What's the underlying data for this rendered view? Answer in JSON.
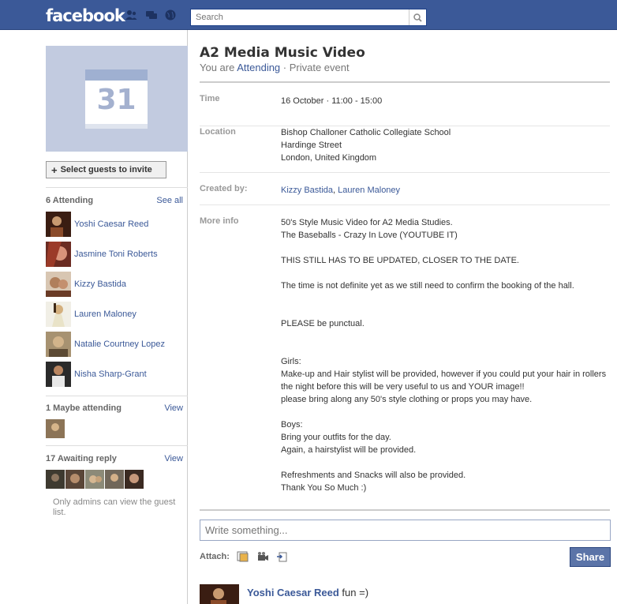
{
  "header": {
    "logo": "facebook",
    "search_placeholder": "Search"
  },
  "sidebar": {
    "calendar_day": "31",
    "invite_label": "Select guests to invite",
    "attending": {
      "heading": "6 Attending",
      "link": "See all",
      "guests": [
        {
          "name": "Yoshi Caesar Reed"
        },
        {
          "name": "Jasmine Toni Roberts"
        },
        {
          "name": "Kizzy Bastida"
        },
        {
          "name": "Lauren Maloney"
        },
        {
          "name": "Natalie Courtney Lopez"
        },
        {
          "name": "Nisha Sharp-Grant"
        }
      ]
    },
    "maybe": {
      "heading": "1 Maybe attending",
      "link": "View"
    },
    "awaiting": {
      "heading": "17 Awaiting reply",
      "link": "View",
      "note": "Only admins can view the guest list."
    }
  },
  "event": {
    "title": "A2 Media Music Video",
    "subtitle_prefix": "You are ",
    "rsvp_status": "Attending",
    "subtitle_suffix": " · Private event",
    "time_label": "Time",
    "time_value": "16 October · 11:00 - 15:00",
    "location_label": "Location",
    "location_value": "Bishop Challoner Catholic Collegiate School\nHardinge Street\nLondon, United Kingdom",
    "created_label": "Created by:",
    "creator_1": "Kizzy Bastida",
    "creator_sep": ", ",
    "creator_2": "Lauren Maloney",
    "info_label": "More info",
    "info_value": "50's Style Music Video for A2 Media Studies.\nThe Baseballs - Crazy In Love (YOUTUBE IT)\n\nTHIS STILL HAS TO BE UPDATED, CLOSER TO THE DATE.\n\nThe time is not definite yet as we still need to confirm the booking of the hall.\n\n\nPLEASE be punctual.\n\n\nGirls:\nMake-up and Hair stylist will be provided, however if you could put your hair in rollers the night before this will be very useful to us and YOUR image!!\nplease bring along any 50's style clothing or props you may have.\n\nBoys:\nBring your outfits for the day.\nAgain, a hairstylist will be provided.\n\nRefreshments and Snacks will also be provided.\nThank You So Much :)"
  },
  "composer": {
    "placeholder": "Write something...",
    "attach_label": "Attach:",
    "share_label": "Share"
  },
  "feed": {
    "post_author": "Yoshi Caesar Reed",
    "post_text": " fun =)"
  },
  "colors": {
    "brand": "#3b5998",
    "link": "#3b5998",
    "share": "#5b74a8"
  }
}
